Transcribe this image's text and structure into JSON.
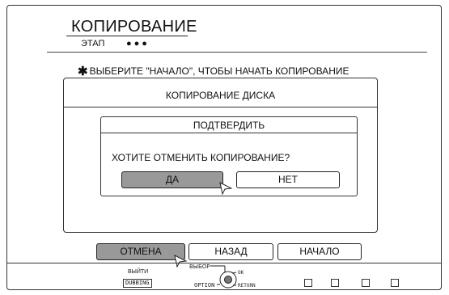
{
  "header": {
    "title": "КОПИРОВАНИЕ",
    "step_label": "ЭТАП",
    "step_dots": "●●●"
  },
  "instruction": {
    "star": "✱",
    "text": "ВЫБЕРИТЕ \"НАЧАЛО\", ЧТОБЫ НАЧАТЬ КОПИРОВАНИЕ"
  },
  "disc_dialog": {
    "title": "КОПИРОВАНИЕ ДИСКА",
    "confirm": {
      "title": "ПОДТВЕРДИТЬ",
      "question": "ХОТИТЕ ОТМЕНИТЬ КОПИРОВАНИЕ?",
      "yes_label": "ДА",
      "no_label": "НЕТ",
      "selected": "yes"
    }
  },
  "bottom_buttons": {
    "cancel_label": "ОТМЕНА",
    "back_label": "НАЗАД",
    "start_label": "НАЧАЛО",
    "selected": "cancel"
  },
  "footer": {
    "exit_label": "ВЫЙТИ",
    "dubbing_label": "DUBBING",
    "select_label": "ВЫБОР",
    "ok_label": "OK",
    "option_label": "OPTION",
    "return_label": "RETURN"
  },
  "colors": {
    "selected_button": "#999999",
    "border": "#333333",
    "background": "#ffffff"
  }
}
